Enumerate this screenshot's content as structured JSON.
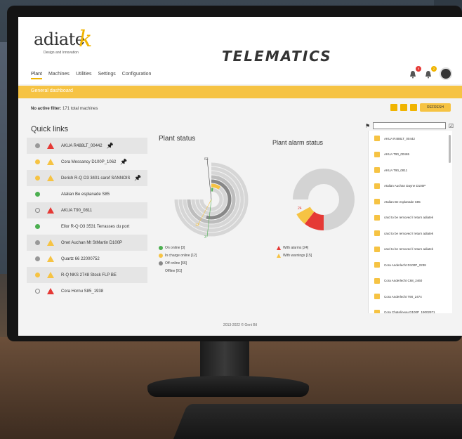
{
  "app": {
    "logo_text": "adiate",
    "logo_k": "k",
    "logo_sub": "Design and Innovation",
    "title": "TELEMATICS"
  },
  "nav": [
    "Plant",
    "Machines",
    "Utilities",
    "Settings",
    "Configuration"
  ],
  "notifications": {
    "alarms": "5",
    "warnings": "2"
  },
  "bar": {
    "title": "General dashboard"
  },
  "filter": {
    "label": "No active filter:",
    "count": "171 total machines"
  },
  "toolbar": {
    "refresh": "REFRESH"
  },
  "quick_links": {
    "title": "Quick links",
    "items": [
      {
        "status": "gray",
        "alert": "red",
        "label": "AKUA R488LT_00442",
        "pinned": true
      },
      {
        "status": "yellow",
        "alert": "yellow",
        "label": "Cora Messancy D100P_1062",
        "pinned": true
      },
      {
        "status": "yellow",
        "alert": "yellow",
        "label": "Derich R-Q O3 3401 caref SANNOIS",
        "pinned": true
      },
      {
        "status": "green",
        "alert": "none",
        "label": "Atalian Be esplanade S85",
        "pinned": false
      },
      {
        "status": "ring",
        "alert": "red",
        "label": "AKUA T90_0811",
        "pinned": false
      },
      {
        "status": "green",
        "alert": "none",
        "label": "Ellor R-Q O3 3531 Terrasses du port",
        "pinned": false
      },
      {
        "status": "gray",
        "alert": "yellow",
        "label": "Onet Auchan Mt StMartin D100P",
        "pinned": false
      },
      {
        "status": "gray",
        "alert": "yellow",
        "label": "Quartz 66 22000752",
        "pinned": false
      },
      {
        "status": "yellow",
        "alert": "yellow",
        "label": "R-Q NKS 2748 Stock FLP BE",
        "pinned": false
      },
      {
        "status": "ring",
        "alert": "red",
        "label": "Cora Hornu S85_1938",
        "pinned": false
      }
    ]
  },
  "plant_status": {
    "title": "Plant status",
    "legend": [
      {
        "color": "#4caf50",
        "label": "On online [3]"
      },
      {
        "color": "#f6c343",
        "label": "In charge online [12]"
      },
      {
        "color": "#888888",
        "label": "Off online [66]"
      },
      {
        "color": "none",
        "label": "Offline [91]"
      }
    ]
  },
  "plant_alarm_status": {
    "title": "Plant alarm status",
    "legend": [
      {
        "color": "#e53935",
        "label": "With alarms [24]"
      },
      {
        "color": "#f6c343",
        "label": "With warnings [15]"
      }
    ]
  },
  "chart_data": [
    {
      "type": "radial-bar",
      "title": "Plant status",
      "categories": [
        "On online",
        "In charge online",
        "Off online",
        "Offline"
      ],
      "values": [
        3,
        12,
        66,
        91
      ],
      "data_labels": [
        "3",
        "12",
        "",
        "63"
      ]
    },
    {
      "type": "pie",
      "title": "Plant alarm status",
      "categories": [
        "With alarms",
        "With warnings"
      ],
      "values": [
        24,
        15
      ],
      "data_labels": [
        "24"
      ]
    }
  ],
  "right_list": {
    "items": [
      "AKUA R488LT_00442",
      "AKUA T90_00465",
      "AKUA T90_0811",
      "Atalian Auchan Dayne D100P",
      "Atalian Be esplanade S85",
      "card to be removed / return adiatek",
      "card to be removed / return adiatek",
      "card to be removed / return adiatek",
      "Cora Anderlecht D100P_2238",
      "Cora Anderlecht C68_2460",
      "Cora Anderlecht T90_2474",
      "Cora Chatelineau D100P_19002971"
    ]
  },
  "footer": {
    "text": "2013-2022 © Geni Bil"
  }
}
